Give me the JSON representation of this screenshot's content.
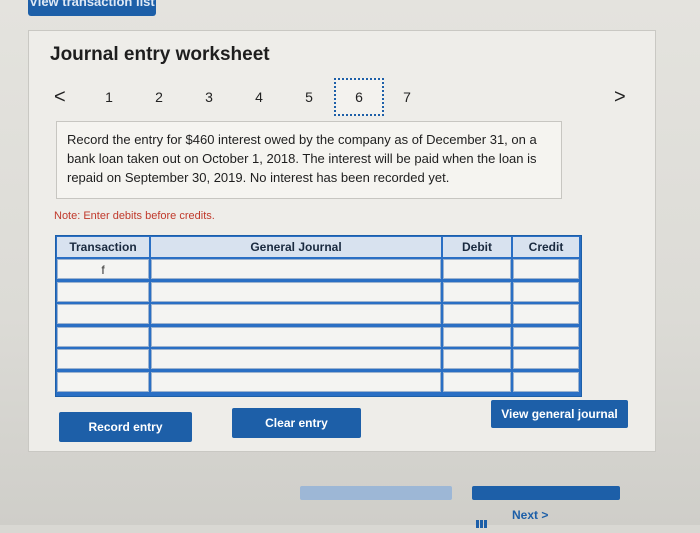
{
  "top_tab": {
    "label": "View transaction list"
  },
  "worksheet": {
    "title": "Journal entry worksheet",
    "steps": [
      "1",
      "2",
      "3",
      "4",
      "5",
      "6",
      "7"
    ],
    "active_step": "6",
    "prev_arrow": "<",
    "next_arrow": ">"
  },
  "question": {
    "text": "Record the entry for $460 interest owed by the company as of December 31, on a bank loan taken out on October 1, 2018. The interest will be paid when the loan is repaid on September 30, 2019. No interest has been recorded yet."
  },
  "note": "Note: Enter debits before credits.",
  "journal": {
    "headers": [
      "Transaction",
      "General Journal",
      "Debit",
      "Credit"
    ],
    "rows": [
      {
        "transaction": "f",
        "account": "",
        "debit": "",
        "credit": ""
      },
      {
        "transaction": "",
        "account": "",
        "debit": "",
        "credit": ""
      },
      {
        "transaction": "",
        "account": "",
        "debit": "",
        "credit": ""
      },
      {
        "transaction": "",
        "account": "",
        "debit": "",
        "credit": ""
      },
      {
        "transaction": "",
        "account": "",
        "debit": "",
        "credit": ""
      },
      {
        "transaction": "",
        "account": "",
        "debit": "",
        "credit": ""
      }
    ]
  },
  "buttons": {
    "record": "Record entry",
    "clear": "Clear entry",
    "view_journal": "View general journal"
  },
  "footer": {
    "next_label": "Next",
    "next_chevron": ">"
  },
  "colors": {
    "accent": "#1d5fa8",
    "note": "#c0392b",
    "panel": "#eeede9"
  }
}
